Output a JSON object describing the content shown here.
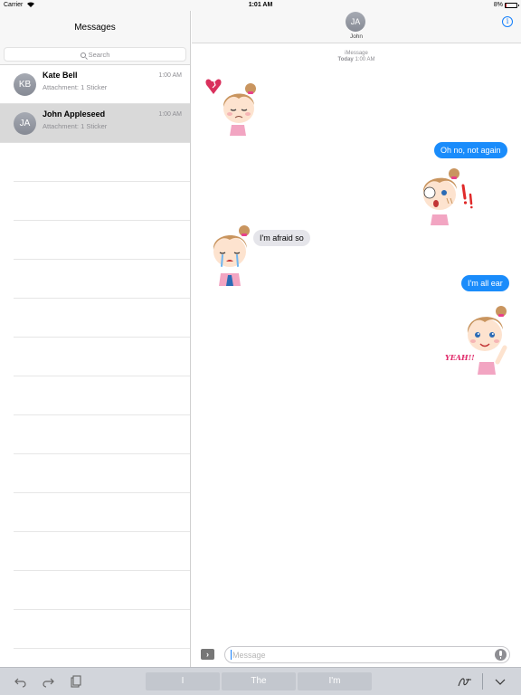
{
  "status_bar": {
    "carrier": "Carrier",
    "time": "1:01 AM",
    "battery": "8%",
    "battery_level": 0.08
  },
  "sidebar": {
    "title": "Messages",
    "search_placeholder": "Search",
    "conversations": [
      {
        "initials": "KB",
        "name": "Kate Bell",
        "time": "1:00 AM",
        "preview": "Attachment: 1 Sticker",
        "selected": false
      },
      {
        "initials": "JA",
        "name": "John Appleseed",
        "time": "1:00 AM",
        "preview": "Attachment: 1 Sticker",
        "selected": true
      }
    ]
  },
  "chat": {
    "contact_initials": "JA",
    "contact_name": "John",
    "service": "iMessage",
    "day": "Today",
    "day_time": "1:00 AM",
    "messages": [
      {
        "direction": "out",
        "text": "Oh no, not again"
      },
      {
        "direction": "in",
        "text": "I'm afraid so"
      },
      {
        "direction": "out",
        "text": "I'm all ear"
      }
    ],
    "stickers": [
      "sad-girl-broken-heart-sticker",
      "shocked-girl-sticker",
      "crying-girl-sticker",
      "happy-waving-girl-sticker"
    ],
    "sticker_text": "YEAH!!",
    "compose_placeholder": "Message",
    "apps_glyph": "›"
  },
  "keyboard_bar": {
    "predictions": [
      "I",
      "The",
      "I'm"
    ],
    "icons": [
      "undo-icon",
      "redo-icon",
      "paste-icon",
      "handwriting-icon",
      "dismiss-keyboard-icon"
    ]
  },
  "colors": {
    "imessage_blue": "#1a8cfb",
    "incoming_gray": "#e5e5ea",
    "selected_row": "#d9d9d9",
    "tint": "#147efb"
  }
}
